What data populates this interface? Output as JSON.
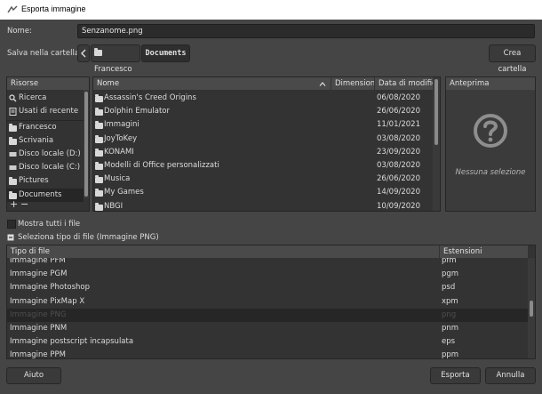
{
  "title": "Esporta immagine",
  "name_label": "Nome:",
  "name_value": "Senzanome.png",
  "save_in_label": "Salva nella cartella:",
  "path": [
    "Francesco",
    "Documents"
  ],
  "create_folder": "Crea cartella",
  "places": {
    "header": "Risorse",
    "items": [
      {
        "label": "Ricerca",
        "icon": "search-icon"
      },
      {
        "label": "Usati di recente",
        "icon": "recent-icon"
      },
      {
        "label": "Francesco",
        "icon": "folder-icon"
      },
      {
        "label": "Scrivania",
        "icon": "folder-icon"
      },
      {
        "label": "Disco locale (D:)",
        "icon": "drive-icon"
      },
      {
        "label": "Disco locale (C:)",
        "icon": "drive-icon"
      },
      {
        "label": "Pictures",
        "icon": "folder-icon"
      },
      {
        "label": "Documents",
        "icon": "folder-icon",
        "selected": true
      }
    ],
    "add": "+",
    "remove": "−"
  },
  "files": {
    "headers": {
      "name": "Nome",
      "size": "Dimensione",
      "date": "Data di modifica"
    },
    "rows": [
      {
        "name": "Assassin's Creed Origins",
        "date": "06/08/2020"
      },
      {
        "name": "Dolphin Emulator",
        "date": "26/06/2020"
      },
      {
        "name": "Immagini",
        "date": "11/01/2021"
      },
      {
        "name": "JoyToKey",
        "date": "03/08/2020"
      },
      {
        "name": "KONAMI",
        "date": "23/09/2020"
      },
      {
        "name": "Modelli di Office personalizzati",
        "date": "03/08/2020"
      },
      {
        "name": "Musica",
        "date": "26/06/2020"
      },
      {
        "name": "My Games",
        "date": "14/09/2020"
      },
      {
        "name": "NBGI",
        "date": "10/09/2020"
      }
    ]
  },
  "preview": {
    "header": "Anteprima",
    "empty": "Nessuna selezione"
  },
  "show_all_files": "Mostra tutti i file",
  "file_type_toggle": "Seleziona tipo di file (Immagine PNG)",
  "types": {
    "headers": {
      "type": "Tipo di file",
      "ext": "Estensioni"
    },
    "rows": [
      {
        "type": "Immagine PFM",
        "ext": "pfm"
      },
      {
        "type": "Immagine PGM",
        "ext": "pgm"
      },
      {
        "type": "Immagine Photoshop",
        "ext": "psd"
      },
      {
        "type": "Immagine PixMap X",
        "ext": "xpm"
      },
      {
        "type": "Immagine PNG",
        "ext": "png",
        "selected": true
      },
      {
        "type": "Immagine PNM",
        "ext": "pnm"
      },
      {
        "type": "Immagine postscript incapsulata",
        "ext": "eps"
      },
      {
        "type": "Immagine PPM",
        "ext": "ppm"
      }
    ]
  },
  "buttons": {
    "help": "Aiuto",
    "export": "Esporta",
    "cancel": "Annulla"
  }
}
